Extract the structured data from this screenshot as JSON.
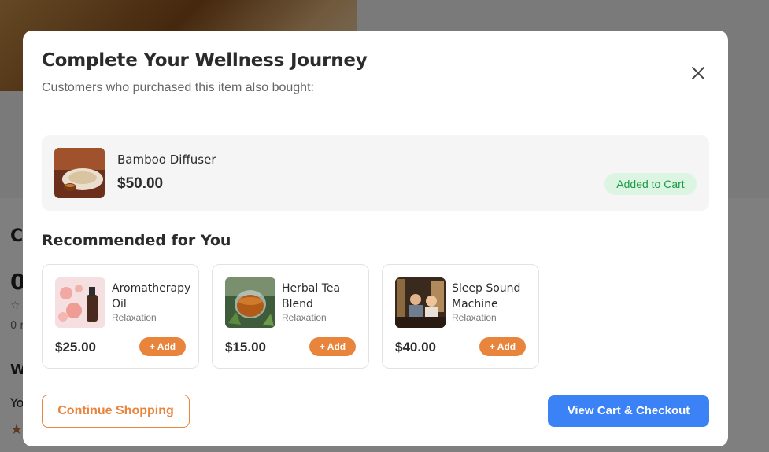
{
  "background": {
    "heading": "C",
    "value": "0",
    "rating_text": "0 r",
    "section_heading": "W",
    "body_text": "Yo"
  },
  "modal": {
    "title": "Complete Your Wellness Journey",
    "subtitle": "Customers who purchased this item also bought:",
    "close_icon": "close-icon"
  },
  "added_item": {
    "name": "Bamboo Diffuser",
    "price": "$50.00",
    "badge": "Added to Cart"
  },
  "recommended": {
    "heading": "Recommended for You",
    "items": [
      {
        "name": "Aromatherapy Oil",
        "category": "Relaxation",
        "price": "$25.00",
        "add_label": "+ Add"
      },
      {
        "name": "Herbal Tea Blend",
        "category": "Relaxation",
        "price": "$15.00",
        "add_label": "+ Add"
      },
      {
        "name": "Sleep Sound Machine",
        "category": "Relaxation",
        "price": "$40.00",
        "add_label": "+ Add"
      }
    ]
  },
  "footer": {
    "continue_label": "Continue Shopping",
    "checkout_label": "View Cart & Checkout"
  },
  "colors": {
    "accent_orange": "#e8843c",
    "primary_blue": "#3b82f6",
    "success_green": "#1f9a48"
  }
}
